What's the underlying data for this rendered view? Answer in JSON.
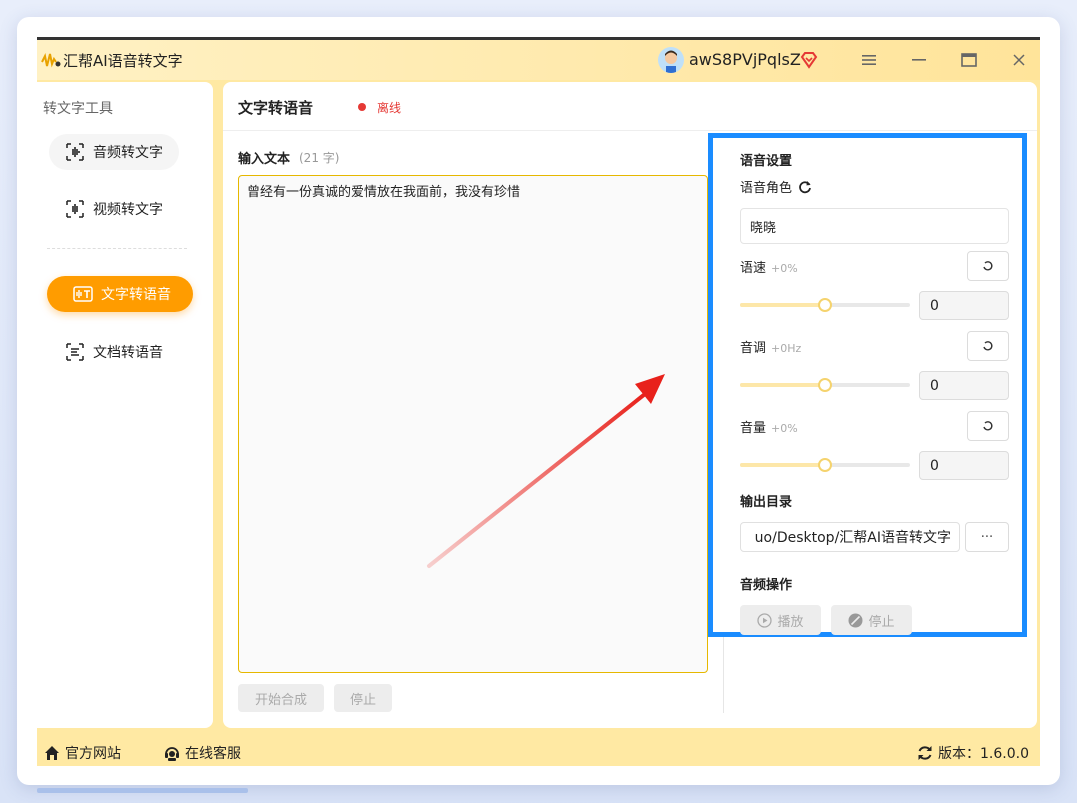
{
  "app": {
    "title": "汇帮AI语音转文字",
    "username": "awS8PVjPqlsZ"
  },
  "window_controls": {
    "menu_icon": "menu-icon",
    "minimize_icon": "minimize-icon",
    "maximize_icon": "maximize-icon",
    "close_icon": "close-icon"
  },
  "sidebar": {
    "title": "转文字工具",
    "items": [
      {
        "label": "音频转文字",
        "icon": "audio-wave-icon"
      },
      {
        "label": "视频转文字",
        "icon": "video-wave-icon"
      },
      {
        "label": "文字转语音",
        "icon": "text-to-speech-icon",
        "active": true
      },
      {
        "label": "文档转语音",
        "icon": "document-speech-icon"
      }
    ]
  },
  "main": {
    "title": "文字转语音",
    "status": "离线",
    "input_label": "输入文本",
    "char_count": "(21 字)",
    "text": "曾经有一份真诚的爱情放在我面前，我没有珍惜",
    "start_button": "开始合成",
    "stop_button": "停止"
  },
  "settings": {
    "title": "语音设置",
    "voice_label": "语音角色",
    "voice_value": "晓晓",
    "speed_label": "语速",
    "speed_sub": "+0%",
    "speed_value": "0",
    "pitch_label": "音调",
    "pitch_sub": "+0Hz",
    "pitch_value": "0",
    "volume_label": "音量",
    "volume_sub": "+0%",
    "volume_value": "0",
    "output_label": "输出目录",
    "output_path": "uo/Desktop/汇帮AI语音转文字",
    "browse_button": "···",
    "audio_ops_label": "音频操作",
    "play_button": "播放",
    "stop_button": "停止",
    "slider_position": 0.5
  },
  "footer": {
    "website": "官方网站",
    "support": "在线客服",
    "version": "版本：1.6.0.0"
  },
  "colors": {
    "accent": "#ff9c00",
    "highlight_border": "#1a8cff",
    "offline": "#e53935",
    "annotation": "#e8211b"
  }
}
